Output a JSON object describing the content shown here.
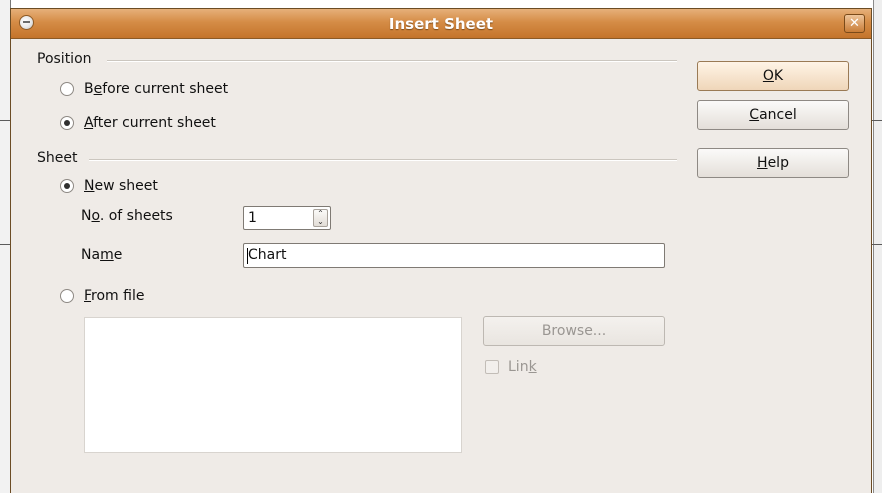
{
  "dialog": {
    "title": "Insert Sheet",
    "close_glyph": "✕"
  },
  "position_section": {
    "label": "Position",
    "options": [
      {
        "pre": "B",
        "key": "e",
        "post": "fore current sheet",
        "checked": false
      },
      {
        "pre": "",
        "key": "A",
        "post": "fter current sheet",
        "checked": true
      }
    ]
  },
  "sheet_section": {
    "label": "Sheet",
    "new_sheet": {
      "pre": "",
      "key": "N",
      "post": "ew sheet",
      "checked": true
    },
    "num_sheets": {
      "pre": "N",
      "key": "o",
      "post": ". of sheets",
      "value": "1"
    },
    "name": {
      "pre": "Na",
      "key": "m",
      "post": "e",
      "value": "Chart"
    },
    "from_file": {
      "pre": "",
      "key": "F",
      "post": "rom file",
      "checked": false
    },
    "browse_label": "Browse...",
    "link": {
      "pre": "Lin",
      "key": "k",
      "post": ""
    }
  },
  "buttons": {
    "ok": {
      "pre": "",
      "key": "O",
      "post": "K"
    },
    "cancel": {
      "pre": "",
      "key": "C",
      "post": "ancel"
    },
    "help": {
      "pre": "",
      "key": "H",
      "post": "elp"
    }
  }
}
